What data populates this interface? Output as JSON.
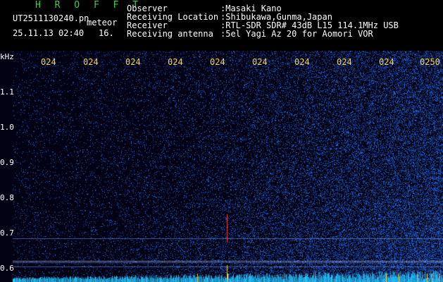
{
  "header": {
    "app_name": "H R O F F T",
    "filename": "UT2511130240.pn",
    "meteor": "meteor",
    "datetime": "25.11.13 02:40",
    "num": "16.",
    "fields": [
      {
        "label": "Observer",
        "value": ":Masaki Kano"
      },
      {
        "label": "Receiving Location",
        "value": ":Shibukawa,Gunma,Japan"
      },
      {
        "label": "Receiver",
        "value": ":RTL-SDR SDR# 43dB L15 114.1MHz USB"
      },
      {
        "label": "Receiving antenna",
        "value": ":5el Yagi Az 20 for Aomori VOR"
      }
    ]
  },
  "spectrogram": {
    "y_unit": "kHz",
    "y_ticks": [
      "1.1",
      "1.0",
      "0.9",
      "0.8",
      "0.7",
      "0.6"
    ],
    "x_ticks": [
      "024",
      "024",
      "024",
      "024",
      "024",
      "024",
      "024",
      "024",
      "024",
      "0250"
    ],
    "colors": {
      "background": "#020214",
      "tick_label": "#ffd23c",
      "header_green": "#3cd23c",
      "signal": "#2a7cff"
    }
  }
}
